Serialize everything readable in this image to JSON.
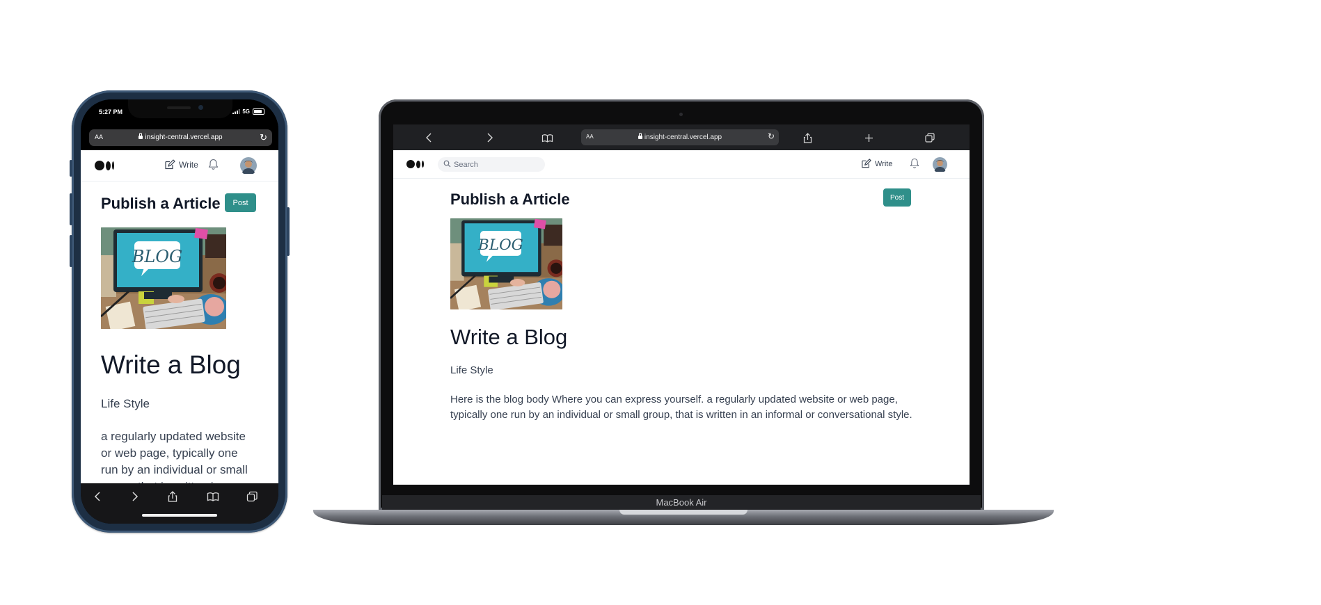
{
  "phone": {
    "status": {
      "time": "5:27 PM",
      "network": "5G"
    },
    "browser": {
      "text_size": "AA",
      "url": "insight-central.vercel.app"
    },
    "nav": {
      "write_label": "Write"
    },
    "page": {
      "heading": "Publish a Article",
      "post_label": "Post",
      "blog_title": "Write a Blog",
      "category": "Life Style",
      "body": "a regularly updated website or web page, typically one run by an individual or small group, that is written in an"
    },
    "toolbar": [
      "back-icon",
      "forward-icon",
      "share-icon",
      "bookmarks-icon",
      "tabs-icon"
    ]
  },
  "laptop": {
    "browser": {
      "text_size": "AA",
      "url": "insight-central.vercel.app"
    },
    "nav": {
      "search_placeholder": "Search",
      "write_label": "Write"
    },
    "page": {
      "heading": "Publish a Article",
      "post_label": "Post",
      "blog_title": "Write a Blog",
      "category": "Life Style",
      "body": "Here is the blog body Where you can express yourself. a regularly updated website or web page, typically one run by an individual or small group, that is written in an informal or conversational style."
    },
    "brand": "MacBook Air"
  },
  "image_text": "BLOG",
  "colors": {
    "accent": "#2f8f8a",
    "text": "#111827",
    "browser_chrome": "#1f2023"
  }
}
